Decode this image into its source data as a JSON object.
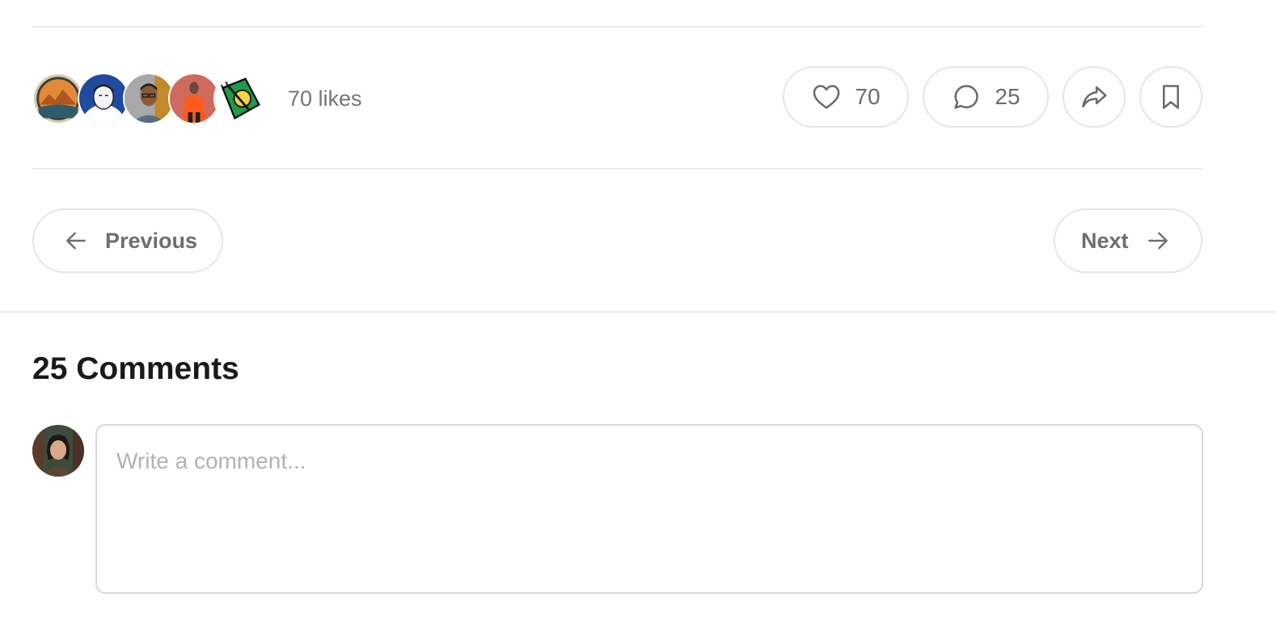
{
  "likes": {
    "label": "70 likes",
    "avatars": [
      {
        "name": "avatar-1",
        "bg": "#e39a3f"
      },
      {
        "name": "avatar-2",
        "bg": "#1f4fa3"
      },
      {
        "name": "avatar-3",
        "bg": "#9a9a9a"
      },
      {
        "name": "avatar-4",
        "bg": "#c8554a"
      },
      {
        "name": "avatar-5",
        "bg": "#1f9a4a"
      }
    ]
  },
  "actions": {
    "like_count": "70",
    "comment_count": "25"
  },
  "nav": {
    "previous_label": "Previous",
    "next_label": "Next"
  },
  "comments": {
    "title": "25 Comments",
    "placeholder": "Write a comment..."
  },
  "colors": {
    "border": "#e6e6e6",
    "muted_text": "#757575",
    "heading": "#1a1a1a"
  }
}
